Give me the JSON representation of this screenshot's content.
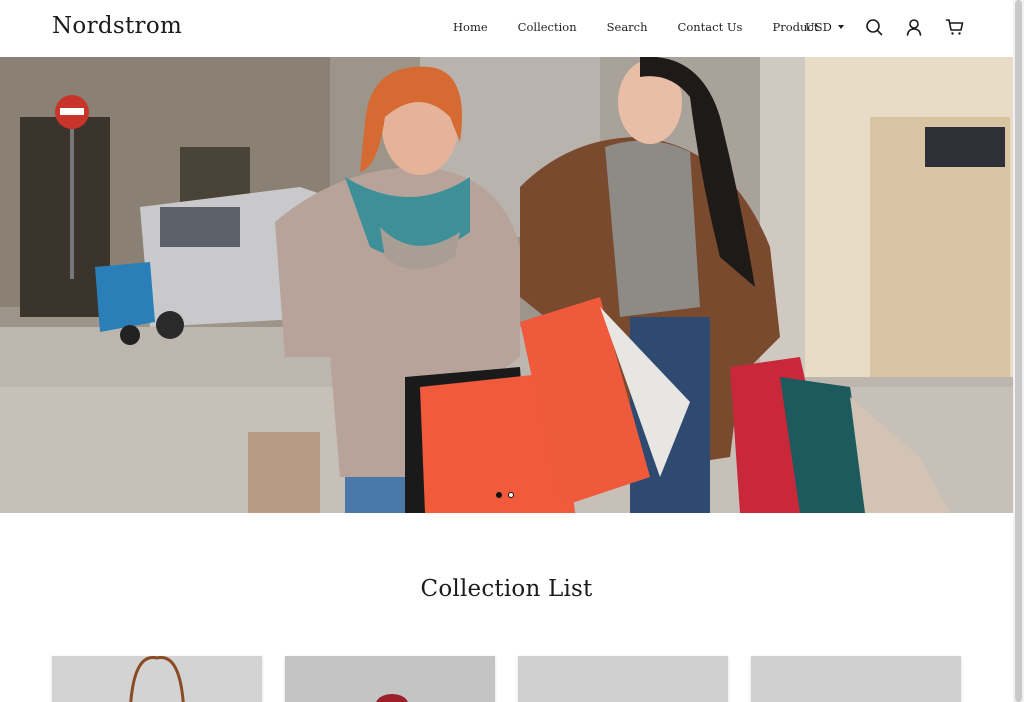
{
  "header": {
    "logo": "Nordstrom",
    "nav": [
      "Home",
      "Collection",
      "Search",
      "Contact Us",
      "Product"
    ],
    "currency": "USD",
    "icons": [
      "search-icon",
      "account-icon",
      "cart-icon"
    ]
  },
  "hero": {
    "image": "two-women-shopping-with-bags",
    "slides": 2,
    "active_slide": 1
  },
  "collection": {
    "title": "Collection List",
    "cards": [
      "handbag-product-image",
      "red-bag-product-image",
      "bag-product-image",
      "bag-product-image"
    ]
  },
  "colors": {
    "text": "#1b1b1b",
    "background": "#ffffff",
    "card_bg": "#d3d3d3"
  }
}
